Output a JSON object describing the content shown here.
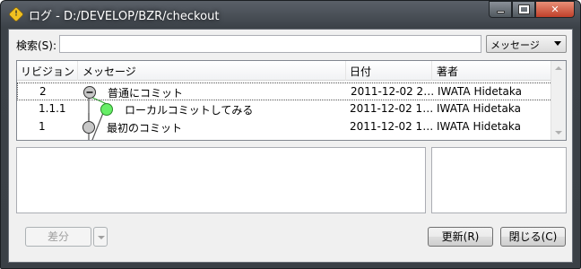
{
  "window": {
    "title": "ログ - D:/DEVELOP/BZR/checkout",
    "app_icon_glyph": "!",
    "minimize_icon": "minimize-icon",
    "maximize_icon": "maximize-icon",
    "close_glyph": "✕"
  },
  "search": {
    "label": "検索(S):",
    "value": "",
    "field_selector": "メッセージ"
  },
  "columns": {
    "revision": "リビジョン",
    "message": "メッセージ",
    "date": "日付",
    "author": "著者"
  },
  "rows": [
    {
      "revision": "2",
      "message": "普通にコミット",
      "date": "2011-12-02 2…",
      "author": "IWATA Hidetaka",
      "node": "expanded-minus",
      "node_color": "#c8c8c8"
    },
    {
      "revision": "1.1.1",
      "message": "ローカルコミットしてみる",
      "date": "2011-12-02 1…",
      "author": "IWATA Hidetaka",
      "node": "merge",
      "node_color": "#66ee66"
    },
    {
      "revision": "1",
      "message": "最初のコミット",
      "date": "2011-12-02 1…",
      "author": "IWATA Hidetaka",
      "node": "plain",
      "node_color": "#c8c8c8"
    }
  ],
  "buttons": {
    "diff": "差分",
    "refresh": "更新(R)",
    "close": "閉じる(C)"
  },
  "colors": {
    "titlebar": "#3c4248",
    "client_bg": "#f0f0f0",
    "merge_node": "#66ee66",
    "merge_line": "#33aa33"
  }
}
